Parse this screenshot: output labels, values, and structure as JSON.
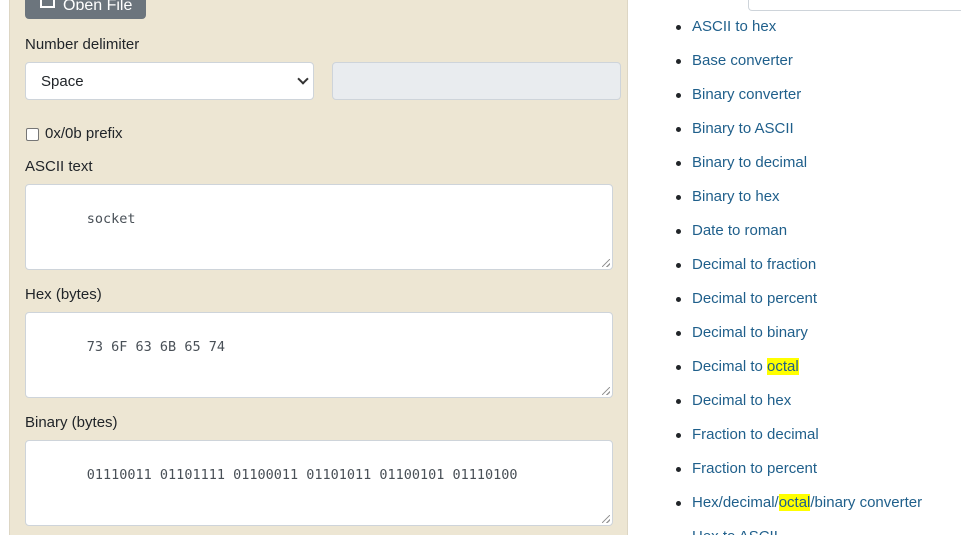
{
  "form": {
    "open_file_label": "Open File",
    "number_delimiter_label": "Number delimiter",
    "delimiter_selected": "Space",
    "prefix_label": "0x/0b prefix",
    "prefix_checked": false,
    "ascii_label": "ASCII text",
    "ascii_value": "socket",
    "hex_label": "Hex (bytes)",
    "hex_value": "73 6F 63 6B 65 74",
    "binary_label": "Binary (bytes)",
    "binary_value": "01110011 01101111 01100011 01101011 01100101 01110100"
  },
  "links": [
    {
      "pre": "ASCII to hex",
      "hl": "",
      "post": ""
    },
    {
      "pre": "Base converter",
      "hl": "",
      "post": ""
    },
    {
      "pre": "Binary converter",
      "hl": "",
      "post": ""
    },
    {
      "pre": "Binary to ASCII",
      "hl": "",
      "post": ""
    },
    {
      "pre": "Binary to decimal",
      "hl": "",
      "post": ""
    },
    {
      "pre": "Binary to hex",
      "hl": "",
      "post": ""
    },
    {
      "pre": "Date to roman",
      "hl": "",
      "post": ""
    },
    {
      "pre": "Decimal to fraction",
      "hl": "",
      "post": ""
    },
    {
      "pre": "Decimal to percent",
      "hl": "",
      "post": ""
    },
    {
      "pre": "Decimal to binary",
      "hl": "",
      "post": ""
    },
    {
      "pre": "Decimal to ",
      "hl": "octal",
      "post": ""
    },
    {
      "pre": "Decimal to hex",
      "hl": "",
      "post": ""
    },
    {
      "pre": "Fraction to decimal",
      "hl": "",
      "post": ""
    },
    {
      "pre": "Fraction to percent",
      "hl": "",
      "post": ""
    },
    {
      "pre": "Hex/decimal/",
      "hl": "octal",
      "post": "/binary converter"
    },
    {
      "pre": "Hex to ASCII",
      "hl": "",
      "post": ""
    }
  ],
  "colors": {
    "panel_bg": "#ede6d3",
    "link": "#1f5f8b",
    "highlight": "#ffff00"
  }
}
